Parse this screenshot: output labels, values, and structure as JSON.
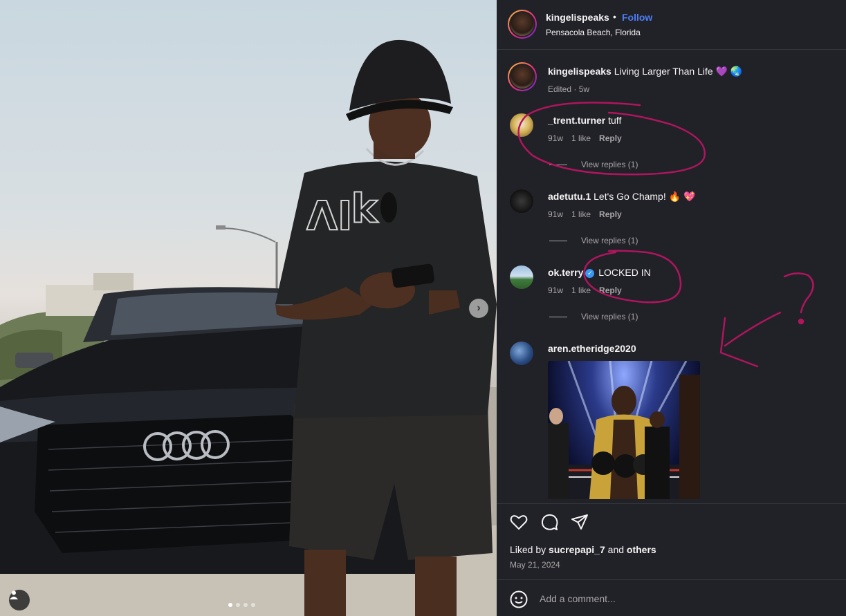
{
  "post": {
    "author": "kingelispeaks",
    "separator": "•",
    "follow_label": "Follow",
    "location": "Pensacola Beach, Florida",
    "caption": "Living Larger Than Life 💜 🌏",
    "caption_meta": "Edited · 5w",
    "liked_by_prefix": "Liked by",
    "liked_by_user": "sucrepapi_7",
    "liked_by_and": "and",
    "liked_by_others": "others",
    "date": "May 21, 2024",
    "add_comment_placeholder": "Add a comment..."
  },
  "comments": [
    {
      "user": "_trent.turner",
      "text": "tuff",
      "age": "91w",
      "likes": "1 like",
      "reply": "Reply",
      "view_replies": "View replies (1)"
    },
    {
      "user": "adetutu.1",
      "text": "Let's Go Champ! 🔥 💖",
      "age": "91w",
      "likes": "1 like",
      "reply": "Reply",
      "view_replies": "View replies (1)"
    },
    {
      "user": "ok.terry",
      "verified_mark": "✓",
      "text": "LOCKED IN",
      "age": "91w",
      "likes": "1 like",
      "reply": "Reply",
      "view_replies": "View replies (1)"
    },
    {
      "user": "aren.etheridge2020",
      "text": ""
    }
  ],
  "carousel": {
    "next_glyph": "›"
  },
  "annotations": {
    "question_mark": "?"
  },
  "colors": {
    "panel_bg": "#212128",
    "link_blue": "#4c7ef5",
    "annotation": "#b0155e",
    "muted": "#a8a8a8"
  },
  "icons": [
    "heart-icon",
    "comment-icon",
    "share-icon",
    "emoji-icon",
    "user-tag-icon",
    "chevron-right-icon",
    "verified-icon"
  ]
}
